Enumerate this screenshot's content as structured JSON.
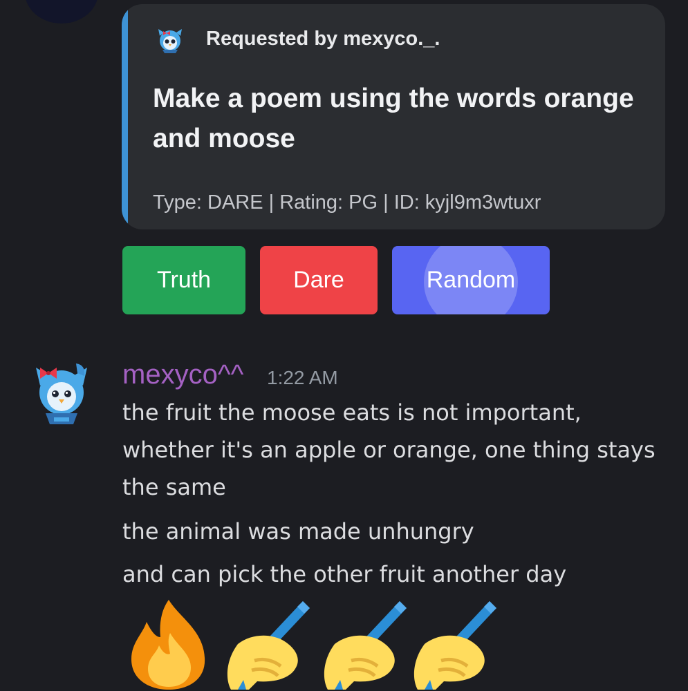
{
  "embed": {
    "author": "Requested by mexyco._.",
    "title": "Make a poem using the words orange and moose",
    "footer": "Type: DARE | Rating: PG | ID: kyjl9m3wtuxr",
    "accent_color": "#3e93d6"
  },
  "buttons": {
    "truth": "Truth",
    "dare": "Dare",
    "random": "Random",
    "truth_color": "#24a457",
    "dare_color": "#ef4347",
    "random_color": "#5865f2"
  },
  "message": {
    "username": "mexyco^^",
    "username_color": "#a461c3",
    "timestamp": "1:22 AM",
    "lines": [
      "the fruit the moose eats is not important,",
      "whether it's an apple or orange, one thing stays",
      "the same",
      "the animal was made unhungry",
      "and can pick the other fruit another day"
    ],
    "reactions": [
      "fire-emoji",
      "writing-hand-emoji",
      "writing-hand-emoji",
      "writing-hand-emoji"
    ]
  }
}
